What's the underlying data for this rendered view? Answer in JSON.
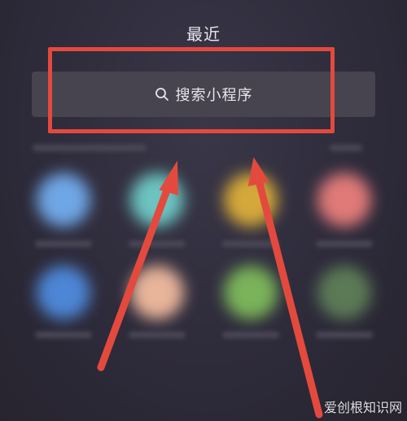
{
  "header": {
    "title": "最近"
  },
  "search": {
    "label": "搜索小程序",
    "icon": "search-icon"
  },
  "annotation": {
    "box_color": "#e34a3d",
    "arrow_color": "#e34a3d"
  },
  "watermark": {
    "text": "爱创根知识网"
  },
  "apps": [
    {
      "color": "#6fa6e6"
    },
    {
      "color": "#6cc3c0"
    },
    {
      "color": "#d4a83a"
    },
    {
      "color": "#e07a78"
    },
    {
      "color": "#4d86d6"
    },
    {
      "color": "#e8b49a"
    },
    {
      "color": "#7ab35a"
    },
    {
      "color": "#5c7a56"
    }
  ]
}
